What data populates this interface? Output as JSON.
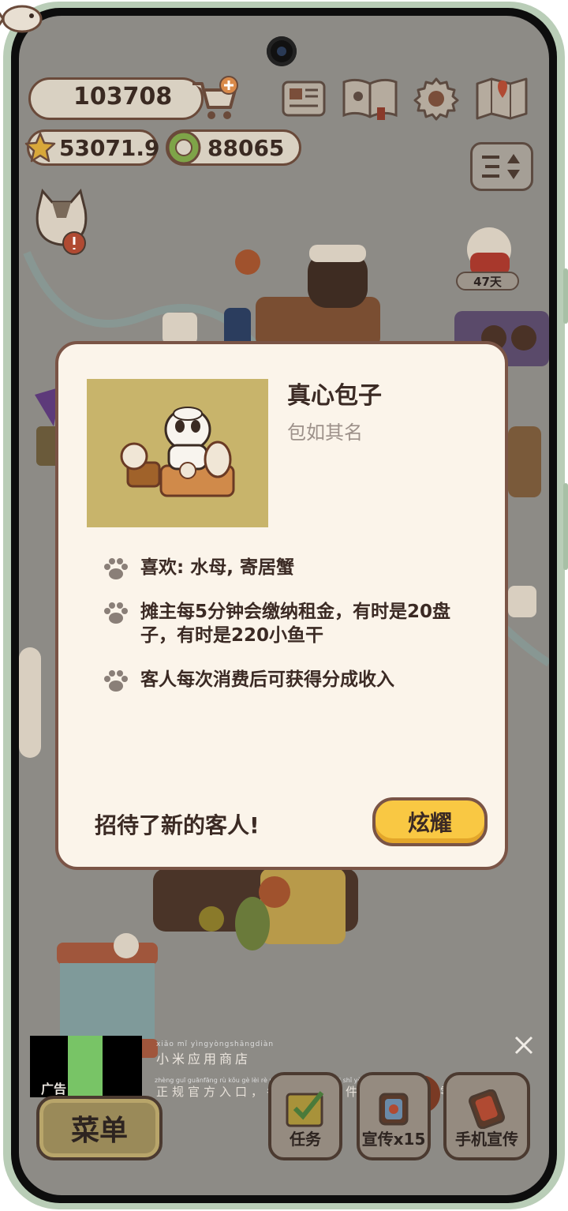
{
  "resources": {
    "fish": "103708",
    "stars": "53071.9",
    "coins": "88065"
  },
  "days_badge": "47天",
  "dialog": {
    "title": "真心包子",
    "subtitle": "包如其名",
    "features": [
      "喜欢: 水母, 寄居蟹",
      "摊主每5分钟会缴纳租金，有时是20盘子，有时是220小鱼干",
      "客人每次消费后可获得分成收入"
    ],
    "welcome": "招待了新的客人!",
    "show_button": "炫耀"
  },
  "ad": {
    "label": "广告",
    "title": "小米应用商店",
    "title_pinyin": "xiǎo mǐ yìngyòngshāngdiàn",
    "description": "正规官方入口，各类热门软件免费使用，零成本…",
    "description_pinyin": "zhèng guī guānfāng rù kǒu   gè lèi rè mén ruǎn jiàn miǎn fèi shǐ yòng   líng chéng běn"
  },
  "bottom_bar": {
    "menu": "菜单",
    "tasks": "任务",
    "promote": "宣传x15",
    "phone_promote": "手机宣传"
  },
  "icons": {
    "fish": "fish-icon",
    "cart": "shop-cart-icon",
    "star": "star-icon",
    "coin": "coin-icon",
    "newspaper": "newspaper-icon",
    "book": "book-icon",
    "settings": "gear-icon",
    "map": "map-icon",
    "filter": "filter-icon",
    "paw": "paw-icon",
    "close": "close-icon"
  },
  "colors": {
    "dialog_bg": "#fbf4ea",
    "dialog_border": "#7a5446",
    "button_yellow": "#f9c843",
    "dim_bg": "#8d8b86"
  }
}
